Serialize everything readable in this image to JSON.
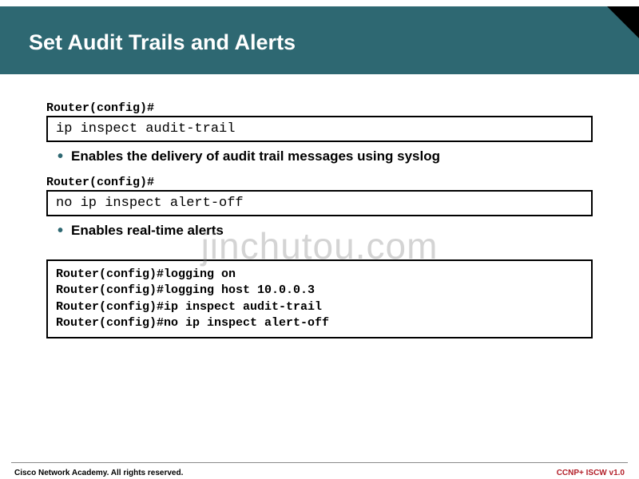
{
  "title": "Set Audit Trails and Alerts",
  "section1": {
    "prompt": "Router(config)#",
    "command": "ip inspect audit-trail",
    "bullet": "Enables the delivery of audit trail messages using syslog"
  },
  "section2": {
    "prompt": "Router(config)#",
    "command": "no ip inspect alert-off",
    "bullet": "Enables real-time alerts"
  },
  "example": {
    "line1": "Router(config)#logging on",
    "line2": "Router(config)#logging host 10.0.0.3",
    "line3": "Router(config)#ip inspect audit-trail",
    "line4": "Router(config)#no ip inspect alert-off"
  },
  "watermark": "jinchutou.com",
  "footer": {
    "left": "Cisco Network Academy. All rights reserved.",
    "right": "CCNP+ ISCW v1.0"
  }
}
